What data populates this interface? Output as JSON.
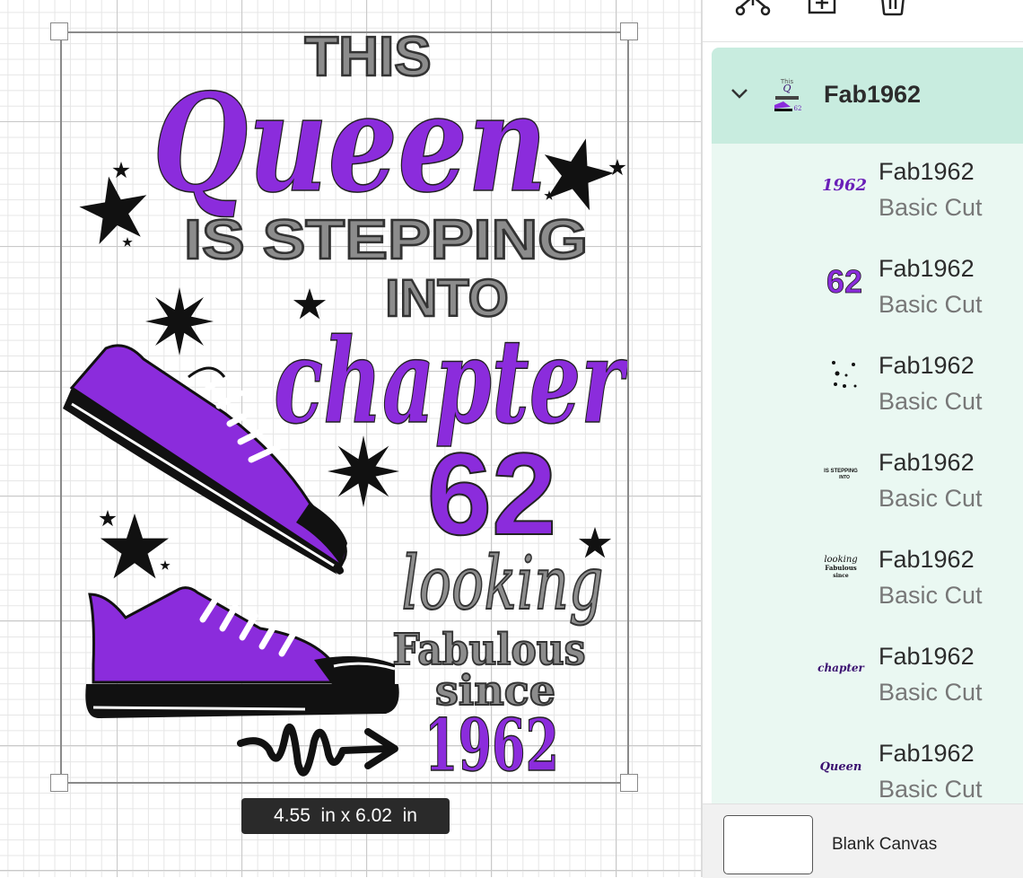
{
  "design": {
    "this": "THIS",
    "queen": "Queen",
    "stepping": "IS STEPPING",
    "into": "INTO",
    "chapter": "chapter",
    "number": "62",
    "looking": "looking",
    "fabulous": "Fabulous",
    "since": "since",
    "year": "1962"
  },
  "size_badge": "4.55  in x 6.02  in",
  "colors": {
    "purple": "#8b2cdc",
    "gray": "#8c8c8c",
    "black": "#111111",
    "selected_group_bg": "#c8ecdf",
    "layer_list_bg": "#eaf8f2"
  },
  "panel": {
    "toolbar_icons": [
      "connect-icon",
      "add-layer-icon",
      "trash-icon"
    ],
    "group": {
      "name": "Fab1962",
      "expanded": true
    },
    "layers": [
      {
        "name": "Fab1962",
        "type": "Basic Cut",
        "thumb_text": "1962",
        "thumb_color": "#6a1fb8"
      },
      {
        "name": "Fab1962",
        "type": "Basic Cut",
        "thumb_text": "62",
        "thumb_color": "#8b2cdc"
      },
      {
        "name": "Fab1962",
        "type": "Basic Cut",
        "thumb_text": "",
        "thumb_color": "#111111"
      },
      {
        "name": "Fab1962",
        "type": "Basic Cut",
        "thumb_text": "IS STEPPING INTO",
        "thumb_color": "#111111"
      },
      {
        "name": "Fab1962",
        "type": "Basic Cut",
        "thumb_text": "looking Fabulous since",
        "thumb_color": "#111111"
      },
      {
        "name": "Fab1962",
        "type": "Basic Cut",
        "thumb_text": "chapter",
        "thumb_color": "#3a1070"
      },
      {
        "name": "Fab1962",
        "type": "Basic Cut",
        "thumb_text": "Queen",
        "thumb_color": "#3a1070"
      }
    ],
    "blank_canvas": "Blank Canvas"
  }
}
